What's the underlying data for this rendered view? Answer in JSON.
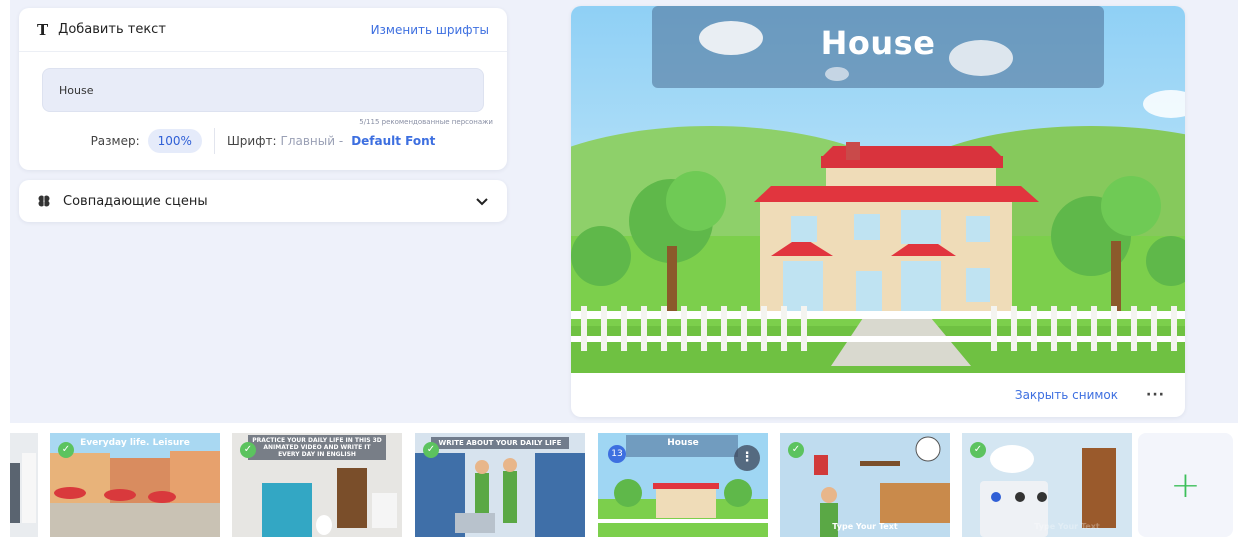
{
  "text_panel": {
    "title": "Добавить текст",
    "change_fonts": "Изменить шрифты",
    "input_value": "House",
    "counter": "5/115 рекомендованные персонажи",
    "size_label": "Размер:",
    "size_value": "100%",
    "font_label": "Шрифт:",
    "font_type": "Главный -",
    "font_name": "Default Font"
  },
  "scenes_panel": {
    "title": "Совпадающие сцены"
  },
  "preview": {
    "scene_title": "House",
    "close_snapshot": "Закрыть снимок",
    "more": "···"
  },
  "timeline": {
    "thumbs": [
      {
        "caption": "Everyday life. Leisure"
      },
      {
        "caption": "PRACTICE YOUR DAILY LIFE IN THIS 3D ANIMATED VIDEO AND WRITE IT EVERY DAY IN ENGLISH"
      },
      {
        "caption": "WRITE ABOUT YOUR DAILY LIFE"
      },
      {
        "caption": "House",
        "number": "13"
      },
      {
        "caption": "Type Your Text"
      },
      {
        "caption": "Type Your Text"
      }
    ],
    "add": "+"
  },
  "colors": {
    "accent": "#3d6fe0",
    "check": "#5cc35f",
    "background": "#eef1fa"
  }
}
